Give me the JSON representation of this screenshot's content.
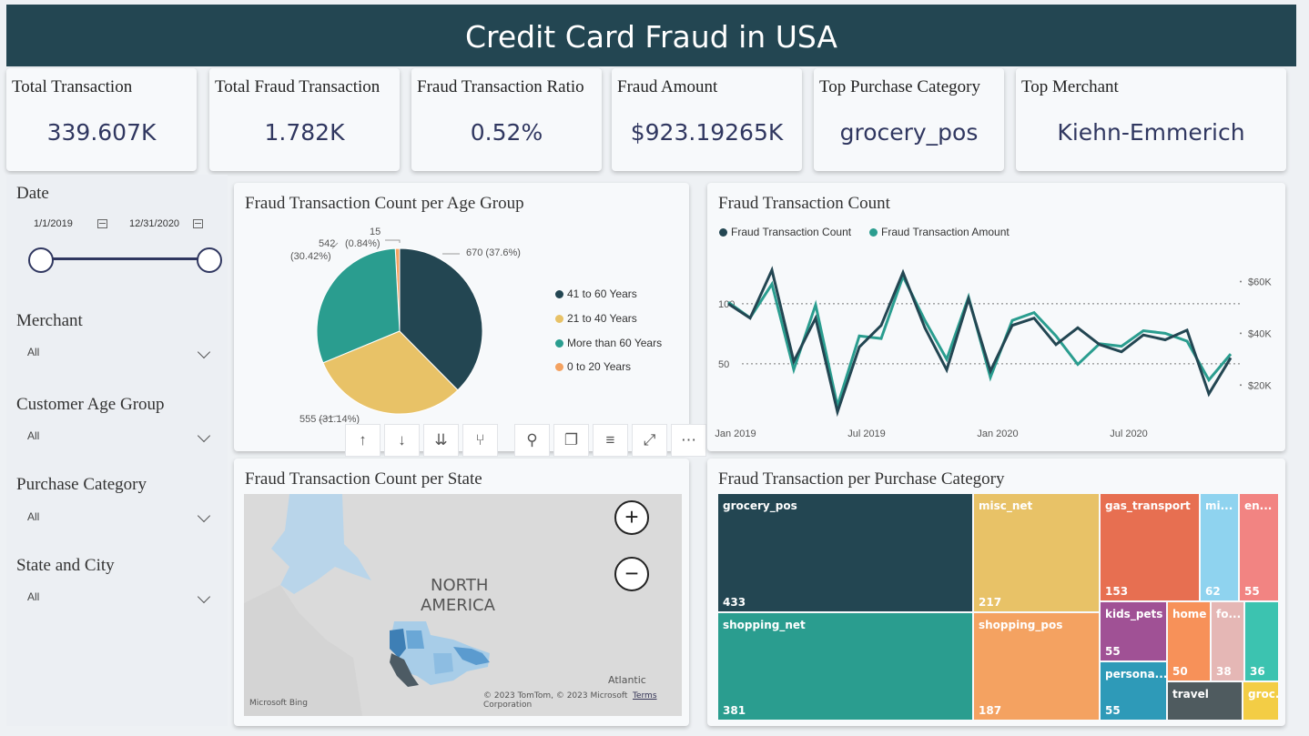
{
  "title": "Credit Card Fraud in USA",
  "kpis": [
    {
      "title": "Total Transaction",
      "value": "339.607K"
    },
    {
      "title": "Total Fraud Transaction",
      "value": "1.782K"
    },
    {
      "title": "Fraud Transaction Ratio",
      "value": "0.52%"
    },
    {
      "title": "Fraud Amount",
      "value": "$923.19265K"
    },
    {
      "title": "Top Purchase Category",
      "value": "grocery_pos"
    },
    {
      "title": "Top Merchant",
      "value": "Kiehn-Emmerich"
    }
  ],
  "filters": {
    "date": {
      "label": "Date",
      "start": "1/1/2019",
      "end": "12/31/2020"
    },
    "merchant": {
      "label": "Merchant",
      "value": "All"
    },
    "age_group": {
      "label": "Customer Age Group",
      "value": "All"
    },
    "purchase_category": {
      "label": "Purchase Category",
      "value": "All"
    },
    "state_city": {
      "label": "State and City",
      "value": "All"
    }
  },
  "pie": {
    "title": "Fraud Transaction Count per Age Group",
    "labels": {
      "a": "670 (37.6%)",
      "b": "555 (31.14%)",
      "c1": "542",
      "c2": "(30.42%)",
      "d1": "15",
      "d2": "(0.84%)"
    }
  },
  "line": {
    "title": "Fraud Transaction Count",
    "legend": [
      "Fraud Transaction Count",
      "Fraud Transaction Amount"
    ],
    "left_ticks": [
      "100",
      "50"
    ],
    "right_ticks": [
      "$60K",
      "$40K",
      "$20K"
    ],
    "x_ticks": [
      "Jan 2019",
      "Jul 2019",
      "Jan 2020",
      "Jul 2020"
    ]
  },
  "map": {
    "title": "Fraud Transaction Count per State",
    "region_label_1": "NORTH",
    "region_label_2": "AMERICA",
    "ocean_label": "Atlantic",
    "attribution": "© 2023 TomTom, © 2023 Microsoft Corporation",
    "terms": "Terms",
    "provider": "Microsoft Bing",
    "zoom_in": "+",
    "zoom_out": "−"
  },
  "treemap": {
    "title": "Fraud Transaction per Purchase Category"
  },
  "toolbar": {
    "up": "↑",
    "down": "↓",
    "expand": "⇊",
    "fork": "⑂",
    "pin": "⚲",
    "copy": "❐",
    "filter": "≡",
    "focus": "⤢",
    "more": "⋯"
  },
  "chart_data": [
    {
      "type": "pie",
      "title": "Fraud Transaction Count per Age Group",
      "series": [
        {
          "values": [
            670,
            555,
            542,
            15
          ]
        }
      ],
      "categories": [
        "41 to 60 Years",
        "21 to 40 Years",
        "More than 60 Years",
        "0 to 20 Years"
      ],
      "percentages": [
        37.6,
        31.14,
        30.42,
        0.84
      ],
      "colors": [
        "#234652",
        "#e8c267",
        "#2a9d8f",
        "#f4a261"
      ],
      "legend": "right"
    },
    {
      "type": "line",
      "title": "Fraud Transaction Count",
      "x": [
        "2019-01",
        "2019-02",
        "2019-03",
        "2019-04",
        "2019-05",
        "2019-06",
        "2019-07",
        "2019-08",
        "2019-09",
        "2019-10",
        "2019-11",
        "2019-12",
        "2020-01",
        "2020-02",
        "2020-03",
        "2020-04",
        "2020-05",
        "2020-06",
        "2020-07",
        "2020-08",
        "2020-09",
        "2020-10",
        "2020-11",
        "2020-12"
      ],
      "series": [
        {
          "name": "Fraud Transaction Count",
          "axis": "left",
          "color": "#234652",
          "values": [
            100,
            88,
            128,
            52,
            88,
            10,
            64,
            82,
            126,
            80,
            45,
            104,
            44,
            82,
            88,
            66,
            80,
            66,
            60,
            74,
            70,
            78,
            25,
            55
          ]
        },
        {
          "name": "Fraud Transaction Amount",
          "axis": "right",
          "color": "#2a9d8f",
          "values": [
            52000,
            46000,
            59000,
            26000,
            51000,
            12000,
            39000,
            38000,
            62000,
            45000,
            30000,
            54000,
            23000,
            45000,
            48000,
            39000,
            28000,
            36000,
            35000,
            41000,
            40000,
            37000,
            22000,
            32000
          ]
        }
      ],
      "ylim_left": [
        0,
        140
      ],
      "ylim_right": [
        5000,
        70000
      ],
      "legend": "top-left",
      "grid": "dotted"
    },
    {
      "type": "treemap",
      "title": "Fraud Transaction per Purchase Category",
      "categories": [
        "grocery_pos",
        "shopping_net",
        "misc_net",
        "shopping_pos",
        "gas_transport",
        "mi...",
        "en...",
        "kids_pets",
        "home",
        "fo...",
        "",
        "persona...",
        "travel",
        "groc..."
      ],
      "values": [
        433,
        381,
        217,
        187,
        153,
        62,
        55,
        55,
        50,
        38,
        36,
        55,
        null,
        null
      ],
      "colors": [
        "#234652",
        "#2a9d8f",
        "#e8c267",
        "#f4a261",
        "#e76f51",
        "#8fd3ef",
        "#f28482",
        "#a05195",
        "#f79159",
        "#e5b7b5",
        "#3cc3b0",
        "#2e9ab8",
        "#4f5b5f",
        "#f3cd45"
      ]
    }
  ]
}
